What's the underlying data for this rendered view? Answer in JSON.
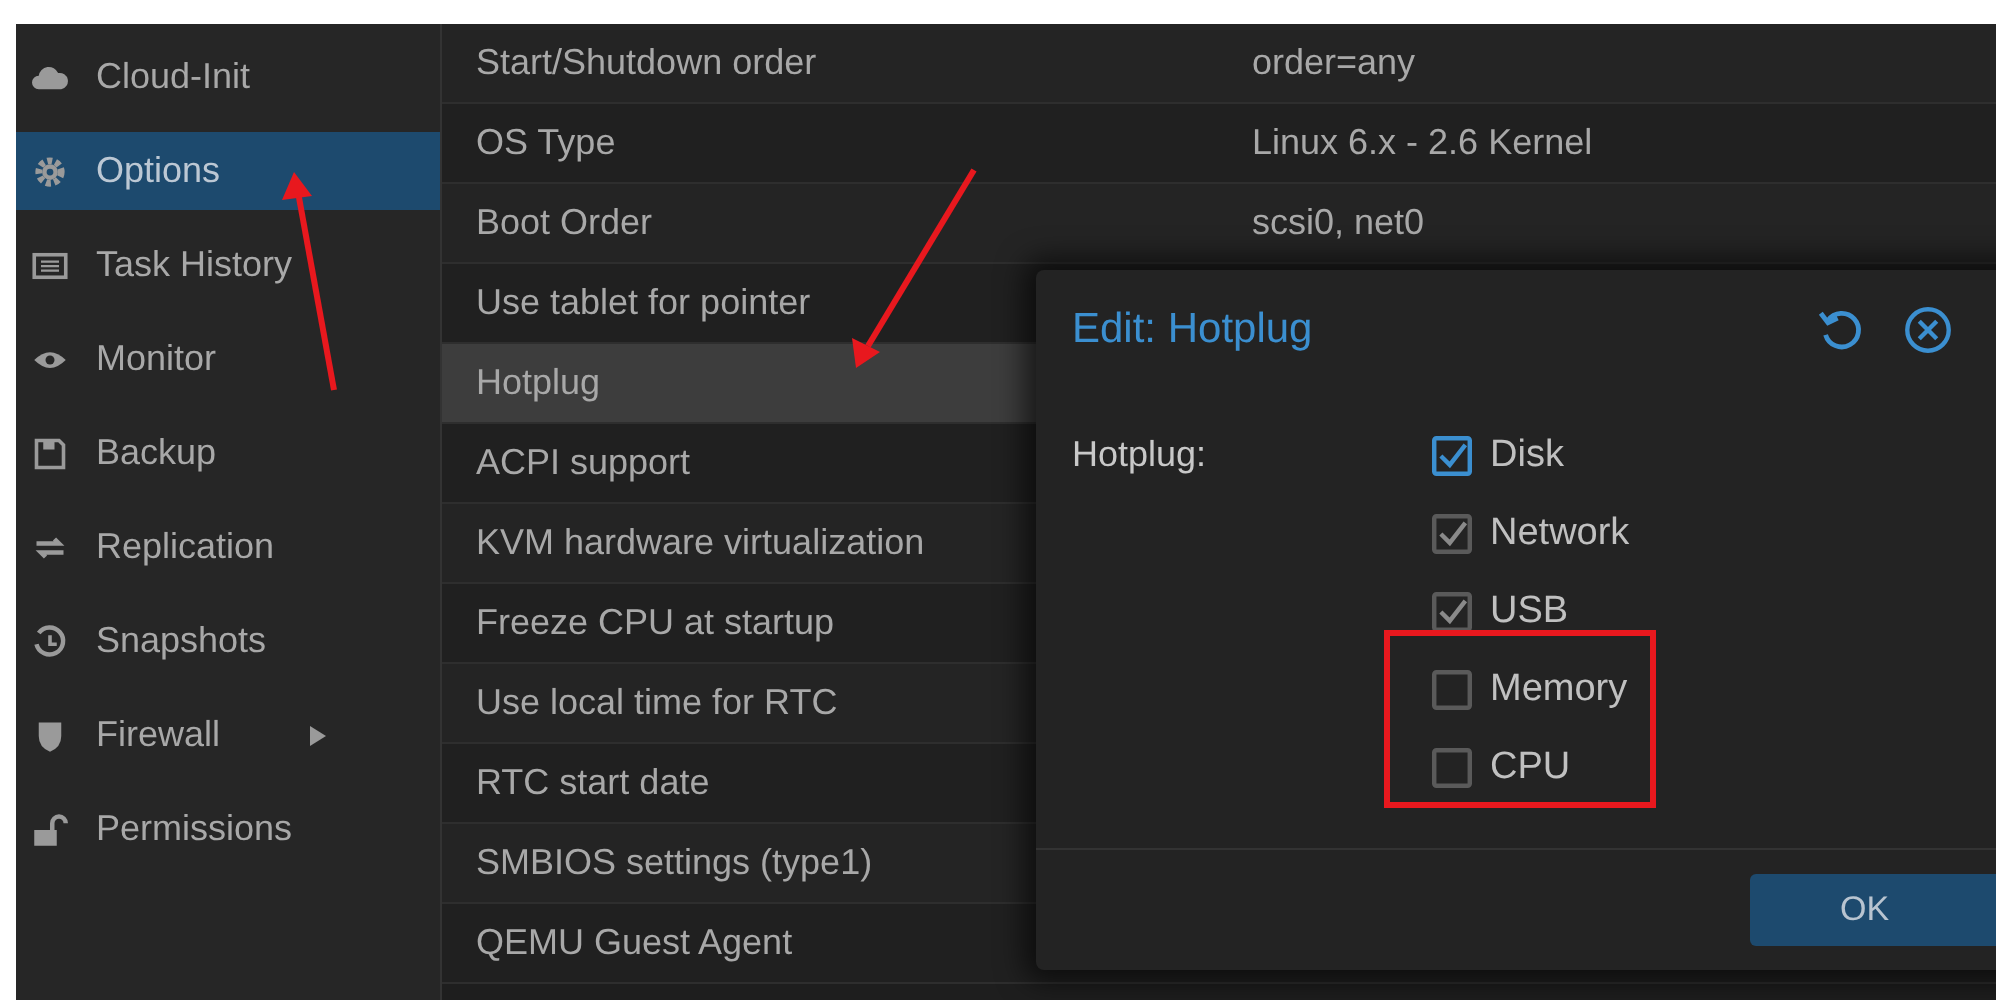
{
  "sidebar": {
    "items": [
      {
        "label": "Cloud-Init",
        "selected": false,
        "has_submenu": false
      },
      {
        "label": "Options",
        "selected": true,
        "has_submenu": false
      },
      {
        "label": "Task History",
        "selected": false,
        "has_submenu": false
      },
      {
        "label": "Monitor",
        "selected": false,
        "has_submenu": false
      },
      {
        "label": "Backup",
        "selected": false,
        "has_submenu": false
      },
      {
        "label": "Replication",
        "selected": false,
        "has_submenu": false
      },
      {
        "label": "Snapshots",
        "selected": false,
        "has_submenu": false
      },
      {
        "label": "Firewall",
        "selected": false,
        "has_submenu": true
      },
      {
        "label": "Permissions",
        "selected": false,
        "has_submenu": false
      }
    ]
  },
  "options": {
    "rows": [
      {
        "name": "Start/Shutdown order",
        "value": "order=any",
        "selected": false
      },
      {
        "name": "OS Type",
        "value": "Linux 6.x - 2.6 Kernel",
        "selected": false
      },
      {
        "name": "Boot Order",
        "value": "scsi0, net0",
        "selected": false
      },
      {
        "name": "Use tablet for pointer",
        "selected": false
      },
      {
        "name": "Hotplug",
        "selected": true
      },
      {
        "name": "ACPI support",
        "selected": false
      },
      {
        "name": "KVM hardware virtualization",
        "selected": false
      },
      {
        "name": "Freeze CPU at startup",
        "selected": false
      },
      {
        "name": "Use local time for RTC",
        "selected": false
      },
      {
        "name": "RTC start date",
        "selected": false
      },
      {
        "name": "SMBIOS settings (type1)",
        "selected": false
      },
      {
        "name": "QEMU Guest Agent",
        "selected": false
      }
    ]
  },
  "dialog": {
    "title": "Edit: Hotplug",
    "field_label": "Hotplug:",
    "options": [
      {
        "label": "Disk",
        "checked": true,
        "focused": true
      },
      {
        "label": "Network",
        "checked": true,
        "focused": false
      },
      {
        "label": "USB",
        "checked": true,
        "focused": false
      },
      {
        "label": "Memory",
        "checked": false,
        "focused": false
      },
      {
        "label": "CPU",
        "checked": false,
        "focused": false
      }
    ],
    "ok_button": "OK"
  }
}
